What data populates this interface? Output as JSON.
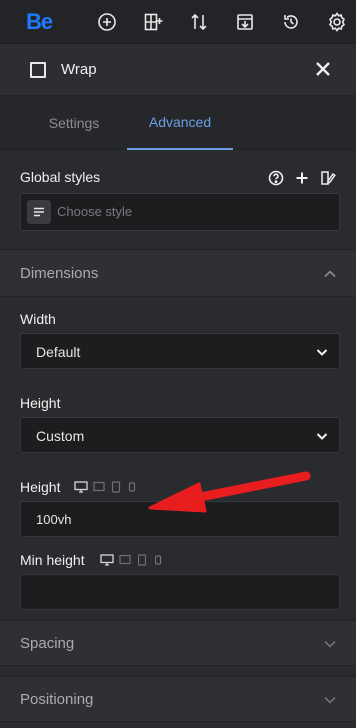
{
  "topbar": {
    "logo": "Be",
    "icons": [
      "add-circle-icon",
      "layout-add-icon",
      "sort-arrows-icon",
      "import-icon",
      "history-icon",
      "settings-gear-icon"
    ]
  },
  "header": {
    "title": "Wrap"
  },
  "tabs": [
    {
      "label": "Settings",
      "active": false
    },
    {
      "label": "Advanced",
      "active": true
    }
  ],
  "global_styles": {
    "label": "Global styles",
    "placeholder": "Choose style"
  },
  "sections": {
    "dimensions": {
      "title": "Dimensions",
      "expanded": true,
      "width": {
        "label": "Width",
        "value": "Default"
      },
      "height_select": {
        "label": "Height",
        "value": "Custom"
      },
      "height_input": {
        "label": "Height",
        "value": "100vh"
      },
      "min_height": {
        "label": "Min height",
        "value": ""
      }
    },
    "spacing": {
      "title": "Spacing",
      "expanded": false
    },
    "positioning": {
      "title": "Positioning",
      "expanded": false
    }
  },
  "colors": {
    "accent": "#6aa0e6",
    "logo": "#1e7bff",
    "annotation_arrow": "#e81d1d"
  }
}
